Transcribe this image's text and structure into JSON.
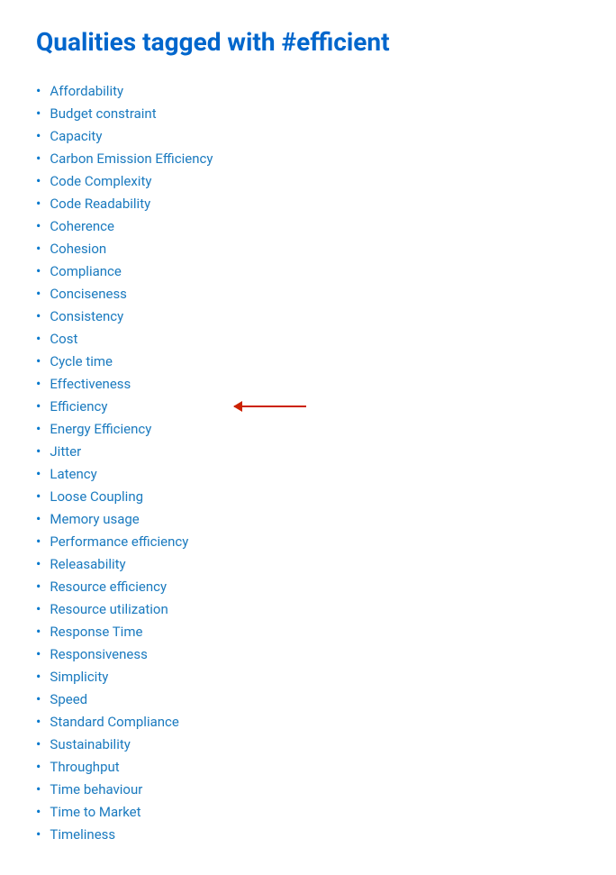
{
  "page": {
    "title": "Qualities tagged with #efficient",
    "items": [
      {
        "label": "Affordability",
        "annotated": false
      },
      {
        "label": "Budget constraint",
        "annotated": false
      },
      {
        "label": "Capacity",
        "annotated": false
      },
      {
        "label": "Carbon Emission Efficiency",
        "annotated": false
      },
      {
        "label": "Code Complexity",
        "annotated": false
      },
      {
        "label": "Code Readability",
        "annotated": false
      },
      {
        "label": "Coherence",
        "annotated": false
      },
      {
        "label": "Cohesion",
        "annotated": false
      },
      {
        "label": "Compliance",
        "annotated": false
      },
      {
        "label": "Conciseness",
        "annotated": false
      },
      {
        "label": "Consistency",
        "annotated": false
      },
      {
        "label": "Cost",
        "annotated": false
      },
      {
        "label": "Cycle time",
        "annotated": false
      },
      {
        "label": "Effectiveness",
        "annotated": false
      },
      {
        "label": "Efficiency",
        "annotated": true
      },
      {
        "label": "Energy Efficiency",
        "annotated": false
      },
      {
        "label": "Jitter",
        "annotated": false
      },
      {
        "label": "Latency",
        "annotated": false
      },
      {
        "label": "Loose Coupling",
        "annotated": false
      },
      {
        "label": "Memory usage",
        "annotated": false
      },
      {
        "label": "Performance efficiency",
        "annotated": false
      },
      {
        "label": "Releasability",
        "annotated": false
      },
      {
        "label": "Resource efficiency",
        "annotated": false
      },
      {
        "label": "Resource utilization",
        "annotated": false
      },
      {
        "label": "Response Time",
        "annotated": false
      },
      {
        "label": "Responsiveness",
        "annotated": false
      },
      {
        "label": "Simplicity",
        "annotated": false
      },
      {
        "label": "Speed",
        "annotated": false
      },
      {
        "label": "Standard Compliance",
        "annotated": false
      },
      {
        "label": "Sustainability",
        "annotated": false
      },
      {
        "label": "Throughput",
        "annotated": false
      },
      {
        "label": "Time behaviour",
        "annotated": false
      },
      {
        "label": "Time to Market",
        "annotated": false
      },
      {
        "label": "Timeliness",
        "annotated": false
      }
    ]
  }
}
